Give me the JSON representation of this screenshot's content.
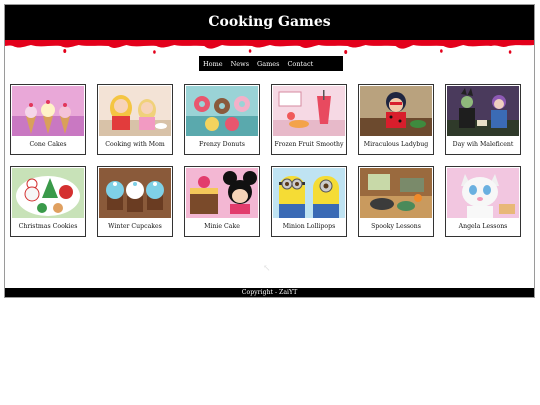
{
  "header": {
    "title": "Cooking Games"
  },
  "nav": {
    "items": [
      "Home",
      "News",
      "Games",
      "Contact"
    ]
  },
  "games": [
    {
      "title": "Cone Cakes",
      "thumb": "cone-cakes-thumbnail"
    },
    {
      "title": "Cooking with Mom",
      "thumb": "cooking-with-mom-thumbnail"
    },
    {
      "title": "Frenzy Donuts",
      "thumb": "frenzy-donuts-thumbnail"
    },
    {
      "title": "Frozen Fruit Smoothy",
      "thumb": "frozen-fruit-smoothy-thumbnail"
    },
    {
      "title": "Miraculous Ladybug",
      "thumb": "miraculous-ladybug-thumbnail"
    },
    {
      "title": "Day wih Maleficent",
      "thumb": "day-with-maleficent-thumbnail"
    },
    {
      "title": "Christmas Cookies",
      "thumb": "christmas-cookies-thumbnail"
    },
    {
      "title": "Winter Cupcakes",
      "thumb": "winter-cupcakes-thumbnail"
    },
    {
      "title": "Minie Cake",
      "thumb": "minie-cake-thumbnail"
    },
    {
      "title": "Minion Lollipops",
      "thumb": "minion-lollipops-thumbnail"
    },
    {
      "title": "Spooky Lessons",
      "thumb": "spooky-lessons-thumbnail"
    },
    {
      "title": "Angela Lessons",
      "thumb": "angela-lessons-thumbnail"
    }
  ],
  "footer": {
    "text": "Copyright - ZaiYT"
  },
  "colors": {
    "header_bg": "#000000",
    "drip": "#e3001b",
    "nav_bg": "#000000",
    "footer_bg": "#000000"
  }
}
